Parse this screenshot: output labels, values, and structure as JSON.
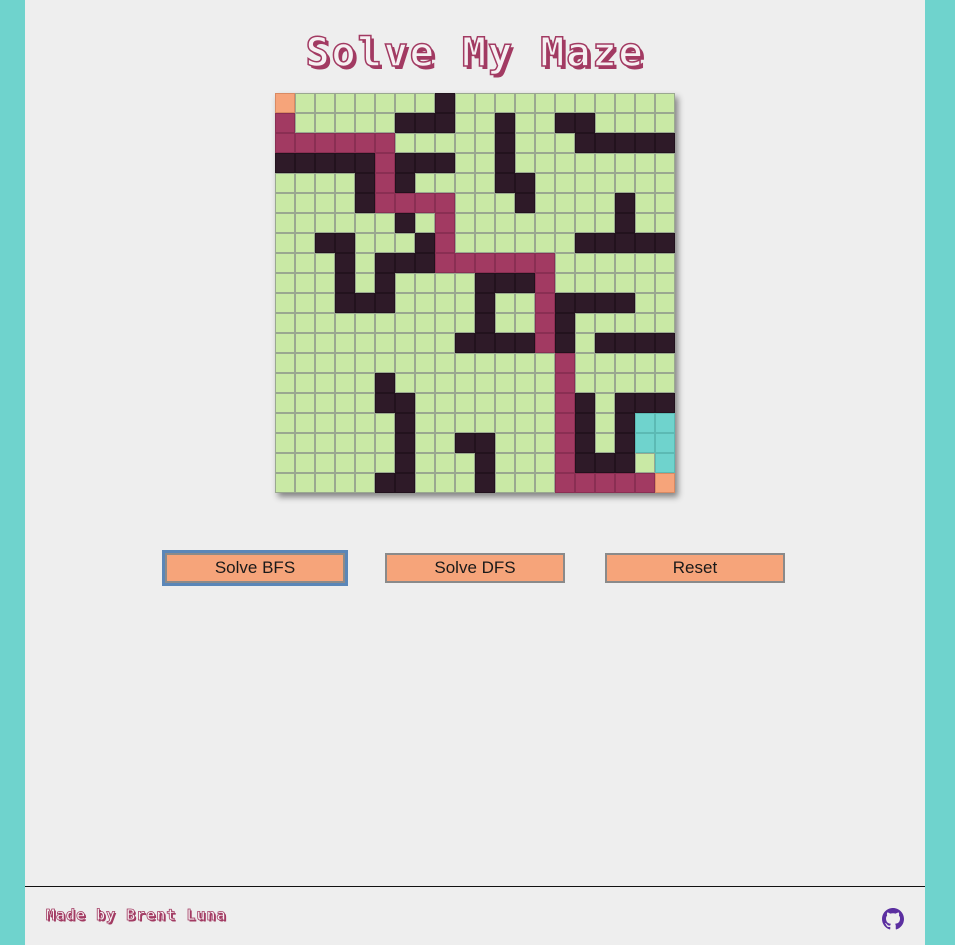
{
  "title": "Solve My Maze",
  "maze": {
    "legend": {
      "0": "open",
      "1": "wall",
      "2": "path",
      "3": "endpoint",
      "4": "visited"
    },
    "rows": [
      "30000000100000000000",
      "20000011100100110000",
      "22222200000100011111",
      "11111211100100000000",
      "00001210000110000000",
      "00001222200010000100",
      "00000010200000000100",
      "00110001200000011111",
      "00010111222222000000",
      "00010100001112000000",
      "00011100001002111100",
      "00000000001002100000",
      "00000000011112101111",
      "00000000000000200000",
      "00000100000000200000",
      "00000110000000210111",
      "00000010000000210144",
      "00000010011000210144",
      "00000010001000211104",
      "00000110001000222223"
    ],
    "colors": {
      "open": "#c9e9a5",
      "wall": "#2e1a28",
      "path": "#a23a62",
      "endpoint": "#f6a47a",
      "visited": "#6fd3cd"
    }
  },
  "buttons": {
    "bfs": "Solve BFS",
    "dfs": "Solve DFS",
    "reset": "Reset"
  },
  "footer": {
    "credit": "Made by Brent Luna",
    "github_icon": "github-icon"
  },
  "colors": {
    "background": "#6fd3cd",
    "panel": "#eeeeee",
    "accent": "#a23a62",
    "button": "#f6a47a",
    "github": "#5b2fa0"
  }
}
